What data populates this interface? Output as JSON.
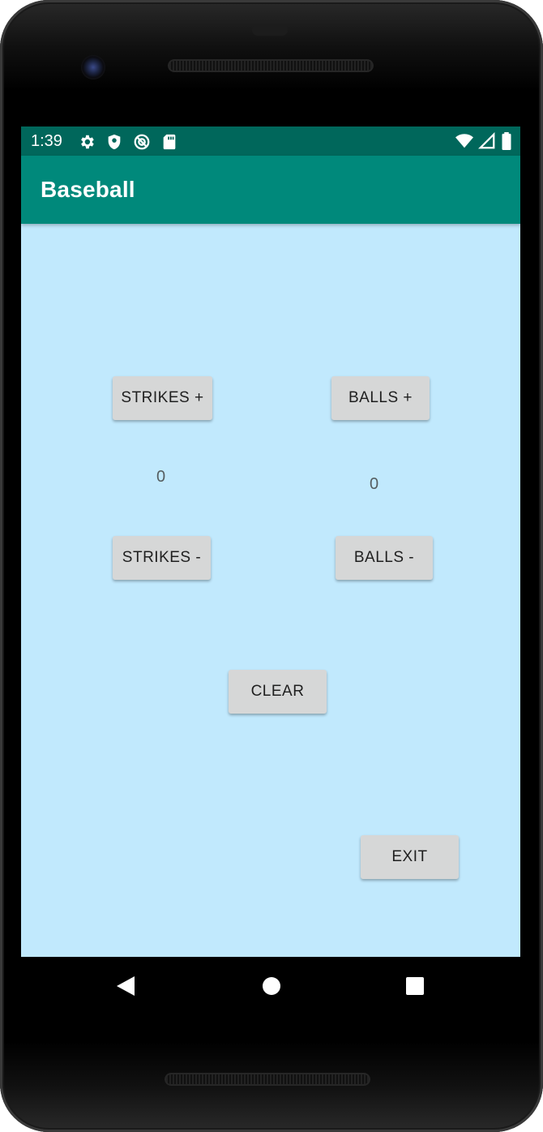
{
  "status_bar": {
    "time": "1:39",
    "left_icons": [
      "settings-icon",
      "shield-icon",
      "do-not-disturb-icon",
      "sd-card-icon"
    ],
    "right_icons": [
      "wifi-icon",
      "signal-icon",
      "battery-icon"
    ]
  },
  "app_bar": {
    "title": "Baseball",
    "color": "#00897b",
    "status_color": "#00675b"
  },
  "main": {
    "background": "#c1e9fd",
    "strikes_plus_label": "STRIKES +",
    "balls_plus_label": "BALLS +",
    "strikes_count": "0",
    "balls_count": "0",
    "strikes_minus_label": "STRIKES -",
    "balls_minus_label": "BALLS -",
    "clear_label": "CLEAR",
    "exit_label": "EXIT"
  },
  "nav_bar": {
    "icons": [
      "back-icon",
      "home-icon",
      "recents-icon"
    ]
  }
}
